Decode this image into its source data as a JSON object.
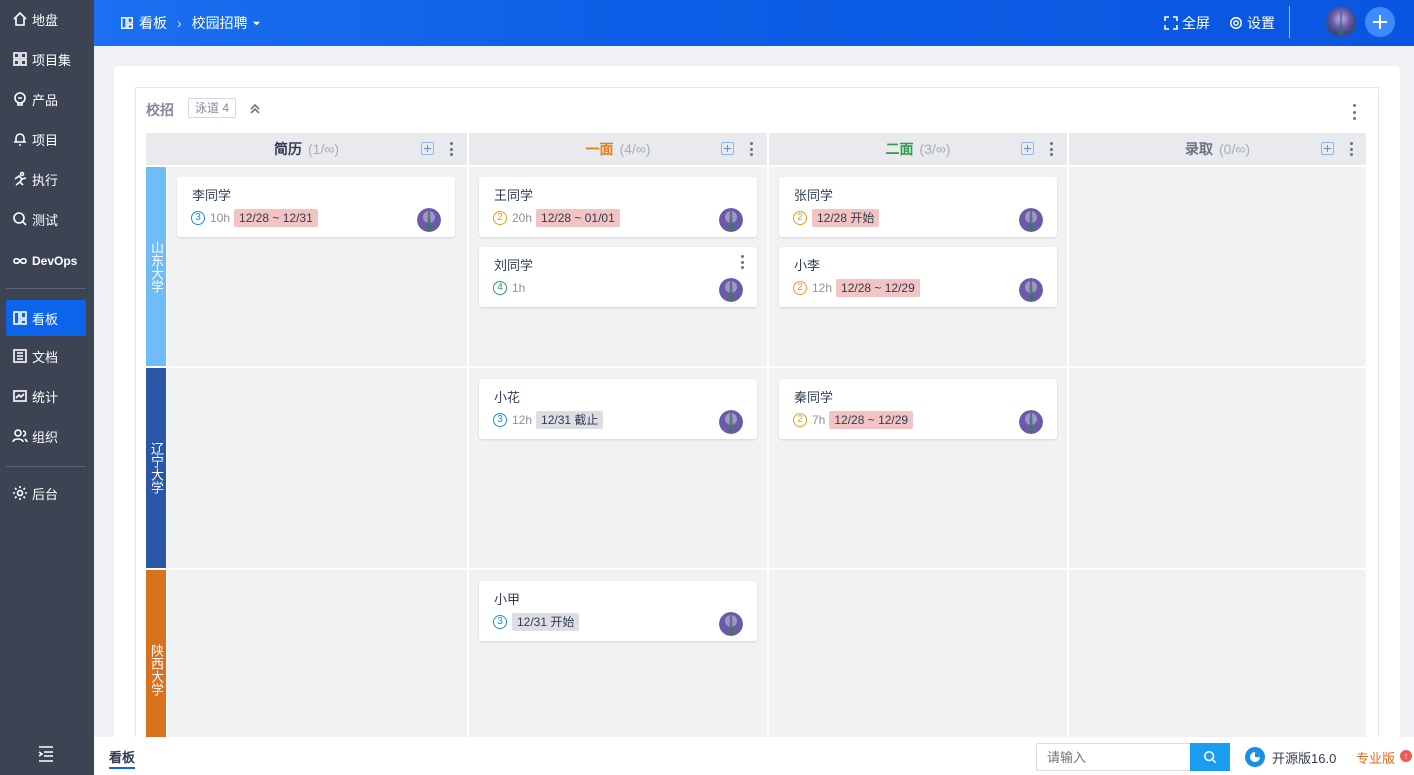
{
  "sidebar": {
    "items": [
      {
        "label": "地盘",
        "icon": "home-icon"
      },
      {
        "label": "项目集",
        "icon": "grid-icon"
      },
      {
        "label": "产品",
        "icon": "bulb-icon"
      },
      {
        "label": "项目",
        "icon": "bell-icon"
      },
      {
        "label": "执行",
        "icon": "run-icon"
      },
      {
        "label": "测试",
        "icon": "search-icon"
      },
      {
        "label": "DevOps",
        "icon": "infinity-icon"
      },
      {
        "label": "看板",
        "icon": "kanban-icon",
        "active": true
      },
      {
        "label": "文档",
        "icon": "doc-icon"
      },
      {
        "label": "统计",
        "icon": "chart-icon"
      },
      {
        "label": "组织",
        "icon": "people-icon"
      },
      {
        "label": "后台",
        "icon": "gear-icon"
      }
    ]
  },
  "header": {
    "crumb_root": "看板",
    "crumb_current": "校园招聘",
    "fullscreen_label": "全屏",
    "settings_label": "设置"
  },
  "board": {
    "title": "校招",
    "lane_count": "泳道 4",
    "columns": [
      {
        "name": "简历",
        "count": "(1/∞)",
        "color": "#313c52"
      },
      {
        "name": "一面",
        "count": "(4/∞)",
        "color": "#e87b1a"
      },
      {
        "name": "二面",
        "count": "(3/∞)",
        "color": "#2e9a4a"
      },
      {
        "name": "录取",
        "count": "(0/∞)",
        "color": "#6d7280"
      }
    ],
    "lanes": [
      {
        "name": "山东大学",
        "color": "#6fbcf7"
      },
      {
        "name": "辽宁大学",
        "color": "#2a56a8"
      },
      {
        "name": "陕西大学",
        "color": "#d9711f"
      }
    ],
    "cards": [
      {
        "name": "李同学",
        "priority": "3",
        "hours": "10h",
        "date": "12/28 ~ 12/31"
      },
      {
        "name": "王同学",
        "priority": "2",
        "hours": "20h",
        "date": "12/28 ~ 01/01"
      },
      {
        "name": "刘同学",
        "priority": "4",
        "hours": "1h",
        "date": ""
      },
      {
        "name": "张同学",
        "priority": "2",
        "hours": "",
        "date": "12/28 开始"
      },
      {
        "name": "小李",
        "priority": "2",
        "hours": "12h",
        "date": "12/28 ~ 12/29"
      },
      {
        "name": "小花",
        "priority": "3",
        "hours": "12h",
        "date": "12/31 截止"
      },
      {
        "name": "秦同学",
        "priority": "2",
        "hours": "7h",
        "date": "12/28 ~ 12/29"
      },
      {
        "name": "小甲",
        "priority": "3",
        "hours": "",
        "date": "12/31 开始"
      }
    ],
    "priority_colors": {
      "2": "#f09a1a",
      "3": "#1a8ee0",
      "4": "#2e9a6a"
    }
  },
  "footer": {
    "tab_label": "看板",
    "search_placeholder": "请输入",
    "oss_version": "开源版16.0",
    "pro_label": "专业版"
  }
}
